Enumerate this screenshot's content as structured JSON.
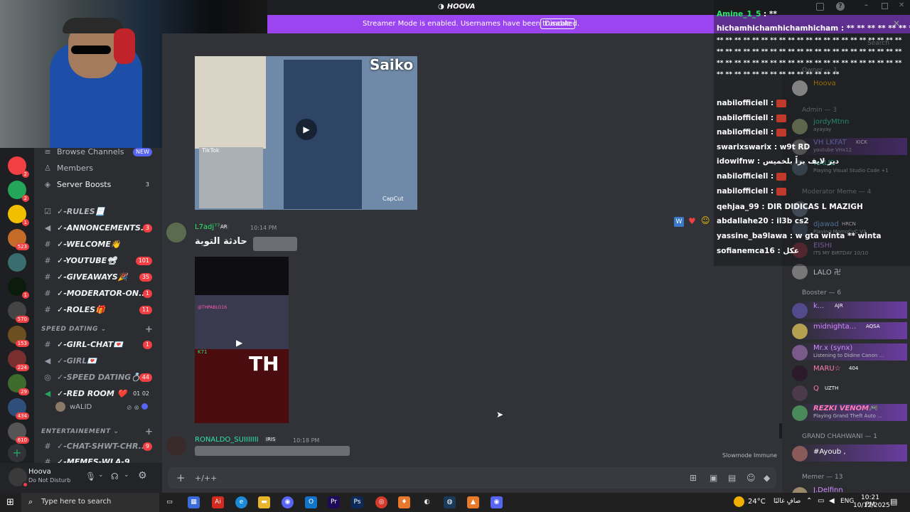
{
  "window": {
    "title": "HOOVA"
  },
  "banner": {
    "message": "Streamer Mode is enabled. Usernames have been truncated.",
    "button": "Disable"
  },
  "sidebar": {
    "items": [
      {
        "label": "Browse Channels",
        "badge": "NEW",
        "icon": "browse-icon"
      },
      {
        "label": "Members",
        "badge": "",
        "icon": "members-icon"
      },
      {
        "label": "Server Boosts",
        "badge": "3",
        "icon": "boost-icon"
      },
      {
        "label": "✓-RULES📃",
        "badge": "",
        "icon": "rules-icon"
      },
      {
        "label": "✓-ANNONCEMENTS...",
        "badge": "3",
        "icon": "announce-icon"
      },
      {
        "label": "✓-WELCOME👋",
        "badge": "",
        "icon": "hash-icon"
      },
      {
        "label": "✓-YOUTUBE📽",
        "badge": "101",
        "icon": "hash-icon"
      },
      {
        "label": "✓-GIVEAWAYS🎉",
        "badge": "35",
        "icon": "hash-icon"
      },
      {
        "label": "✓-MODERATOR-ON...",
        "badge": "1",
        "icon": "hash-icon"
      },
      {
        "label": "✓-ROLES🎁",
        "badge": "11",
        "icon": "hash-icon"
      },
      {
        "label": "✓-GIRL-CHAT💌",
        "badge": "1",
        "icon": "hash-icon"
      },
      {
        "label": "✓-GIRL💌",
        "badge": "",
        "icon": "speaker-icon"
      },
      {
        "label": "✓-SPEED DATING💍",
        "badge": "44",
        "icon": "stage-icon"
      },
      {
        "label": "✓-RED ROOM ❤️",
        "badge": "01 02",
        "icon": "speaker-icon"
      },
      {
        "label": "✓-CHAT-SHWT-CHR...",
        "badge": "9",
        "icon": "hash-icon"
      },
      {
        "label": "✓-MEMES-WLA-9...",
        "badge": "",
        "icon": "hash-icon"
      }
    ],
    "categories": [
      "SPEED DATING",
      "ENTERTAINEMENT"
    ],
    "voice_user": "wALID"
  },
  "user": {
    "name": "Hoova",
    "status": "Do Not Disturb"
  },
  "server_badges": [
    "2",
    "2",
    "2",
    "1",
    "523",
    "1",
    "570",
    "153",
    "224",
    "29",
    "434",
    "610"
  ],
  "chat": {
    "messages": [
      {
        "author": "L7adj⁷⁷",
        "tag": "AR",
        "time": "10:14 PM",
        "text": "حادثة التوبة"
      },
      {
        "author": "RONALDO_SUIIIIIII",
        "tag": "IRIS",
        "time": "10:18 PM",
        "text": ""
      }
    ],
    "video_texts": {
      "saiko": "Saiko",
      "tiktok": "TikTok",
      "capcut": "CapCut",
      "th": "TH",
      "tiktok_user": "@THPABLO16",
      "k71": "K71"
    },
    "slowmode": "Slowmode Immune",
    "composer_placeholder": "+/++"
  },
  "members": {
    "search": "Search",
    "groups": [
      {
        "title": "Owner — 1",
        "members": [
          {
            "name": "Hoova",
            "status": ""
          }
        ]
      },
      {
        "title": "Admin — 3",
        "members": [
          {
            "name": "jordyMtnn",
            "status": "ayayay",
            "color": "#2ee6a8"
          },
          {
            "name": "VH LKFAT",
            "status": "youtube VHx12",
            "tag": "KICK",
            "color": "#8f9cff"
          },
          {
            "name": "wALID",
            "status": "Playing Visual Studio Code +1",
            "color": "#2ee6a8"
          }
        ]
      },
      {
        "title": "Moderator Meme — 4",
        "members": [
          {
            "name": "ghaz...",
            "status": "",
            "color": "#fff"
          },
          {
            "name": "djawad",
            "status": "Playing MomoCvC V3",
            "tag": "HRCN",
            "color": "#7ab8ff"
          },
          {
            "name": "EISHI",
            "status": "ITS MY BIRTDAY 10/10",
            "color": "#c88cff"
          },
          {
            "name": "LALO 卍",
            "status": "",
            "color": "#b5bac1"
          }
        ]
      },
      {
        "title": "Booster — 6",
        "members": [
          {
            "name": "k...",
            "status": "",
            "tag": "AJR",
            "color": "#d28bff"
          },
          {
            "name": "midnighta...",
            "status": "",
            "tag": "AQSA",
            "color": "#d28bff"
          },
          {
            "name": "Mr.x (synx)",
            "status": "Listening to Didine Canon ...",
            "color": "#d28bff"
          },
          {
            "name": "MARU☆",
            "status": "",
            "tag": "404",
            "color": "#ff7bb5"
          },
          {
            "name": "Q",
            "status": "",
            "tag": "UZTH",
            "color": "#ff7bb5"
          },
          {
            "name": "REZKI VENOM🎮",
            "status": "Playing Grand Theft Auto ...",
            "color": "#ff7bb5"
          }
        ]
      },
      {
        "title": "GRAND CHAHWANI — 1",
        "members": [
          {
            "name": "#Ayoub ,",
            "status": "",
            "color": "#ffffff"
          }
        ]
      },
      {
        "title": "Memer — 13",
        "members": [
          {
            "name": "J.Delfinn",
            "status": "",
            "color": "#d28bff"
          }
        ]
      }
    ]
  },
  "overlay_chat": [
    {
      "user": "Amine_1_5",
      "text": "**"
    },
    {
      "user": "hichamhichamhichamhicham",
      "text": "** ** ** ** ** ** ** ** ** ** **"
    },
    {
      "user": "",
      "text": "** ** ** ** ** ** ** ** ** ** ** ** ** ** ** ** ** ** ** ** **"
    },
    {
      "user": "",
      "text": "** ** ** ** ** ** ** ** ** ** ** ** ** ** ** ** ** ** ** ** **"
    },
    {
      "user": "",
      "text": "** ** ** ** ** ** ** ** ** ** ** ** ** ** ** ** ** ** ** ** **"
    },
    {
      "user": "",
      "text": "** ** ** ** ** ** ** ** ** ** ** ** ** **"
    },
    {
      "user": "nabilofficiell",
      "text": ""
    },
    {
      "user": "nabilofficiell",
      "text": ""
    },
    {
      "user": "nabilofficiell",
      "text": ""
    },
    {
      "user": "swarixswarix",
      "text": "w9t RD"
    },
    {
      "user": "idowifnw",
      "text": "دير لايف براً بلخميس"
    },
    {
      "user": "nabilofficiell",
      "text": ""
    },
    {
      "user": "nabilofficiell",
      "text": ""
    },
    {
      "user": "qehjaa_99",
      "text": "DIR DIDICAS L MAZIGH"
    },
    {
      "user": "abdallahe20",
      "text": "il3b cs2"
    },
    {
      "user": "yassine_ba9lawa",
      "text": "w gta winta ** winta"
    },
    {
      "user": "sofianemca16",
      "text": "عكل"
    }
  ],
  "taskbar": {
    "search": "Type here to search",
    "weather": "24°C",
    "weather_desc": "صافٍ غالبًا",
    "lang": "ENG",
    "time": "10:21 PM",
    "date": "10/12/2025"
  },
  "colors": {
    "accent": "#5865f2",
    "banner": "#9b45f0",
    "badge": "#f23f43",
    "online": "#23a55a"
  }
}
